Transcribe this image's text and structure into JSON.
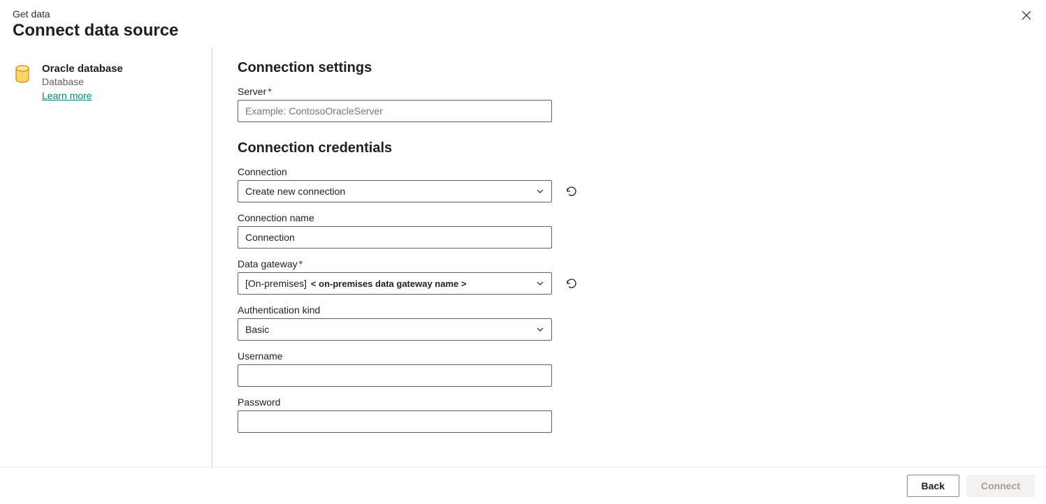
{
  "header": {
    "breadcrumb": "Get data",
    "title": "Connect data source"
  },
  "sidebar": {
    "source_name": "Oracle database",
    "source_type": "Database",
    "learn_more": "Learn more"
  },
  "sections": {
    "connection_settings": {
      "heading": "Connection settings",
      "server": {
        "label": "Server",
        "required_marker": "*",
        "placeholder": "Example: ContosoOracleServer",
        "value": ""
      }
    },
    "connection_credentials": {
      "heading": "Connection credentials",
      "connection": {
        "label": "Connection",
        "value": "Create new connection"
      },
      "connection_name": {
        "label": "Connection name",
        "value": "Connection"
      },
      "data_gateway": {
        "label": "Data gateway",
        "required_marker": "*",
        "prefix": "[On-premises]",
        "hint": "< on-premises data gateway name >"
      },
      "auth_kind": {
        "label": "Authentication kind",
        "value": "Basic"
      },
      "username": {
        "label": "Username",
        "value": ""
      },
      "password": {
        "label": "Password",
        "value": ""
      }
    }
  },
  "footer": {
    "back": "Back",
    "connect": "Connect"
  }
}
